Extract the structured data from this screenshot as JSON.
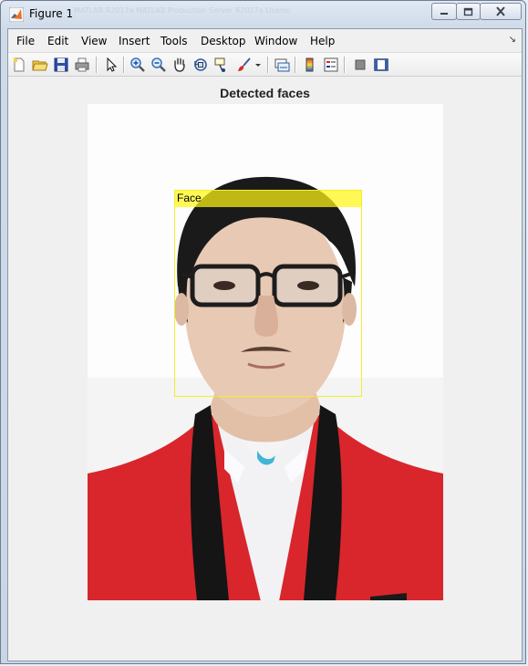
{
  "window": {
    "title": "Figure 1",
    "title_ghost": "MATLAB R2017a MATLAB Production Server R2017a  Lisensi"
  },
  "menu": {
    "items": [
      "File",
      "Edit",
      "View",
      "Insert",
      "Tools",
      "Desktop",
      "Window",
      "Help"
    ]
  },
  "toolbar": {
    "buttons": [
      "new-figure-icon",
      "open-file-icon",
      "save-icon",
      "print-icon",
      "edit-plot-arrow-icon",
      "zoom-in-icon",
      "zoom-out-icon",
      "pan-hand-icon",
      "rotate-3d-icon",
      "data-cursor-icon",
      "brush-icon",
      "link-plot-icon",
      "insert-colorbar-icon",
      "insert-legend-icon",
      "hide-plot-tools-icon",
      "show-plot-tools-icon"
    ]
  },
  "figure": {
    "axes_title": "Detected faces",
    "detection_label": "Face",
    "box_color": "#f2ee2a",
    "label_fill": "#fff514"
  }
}
